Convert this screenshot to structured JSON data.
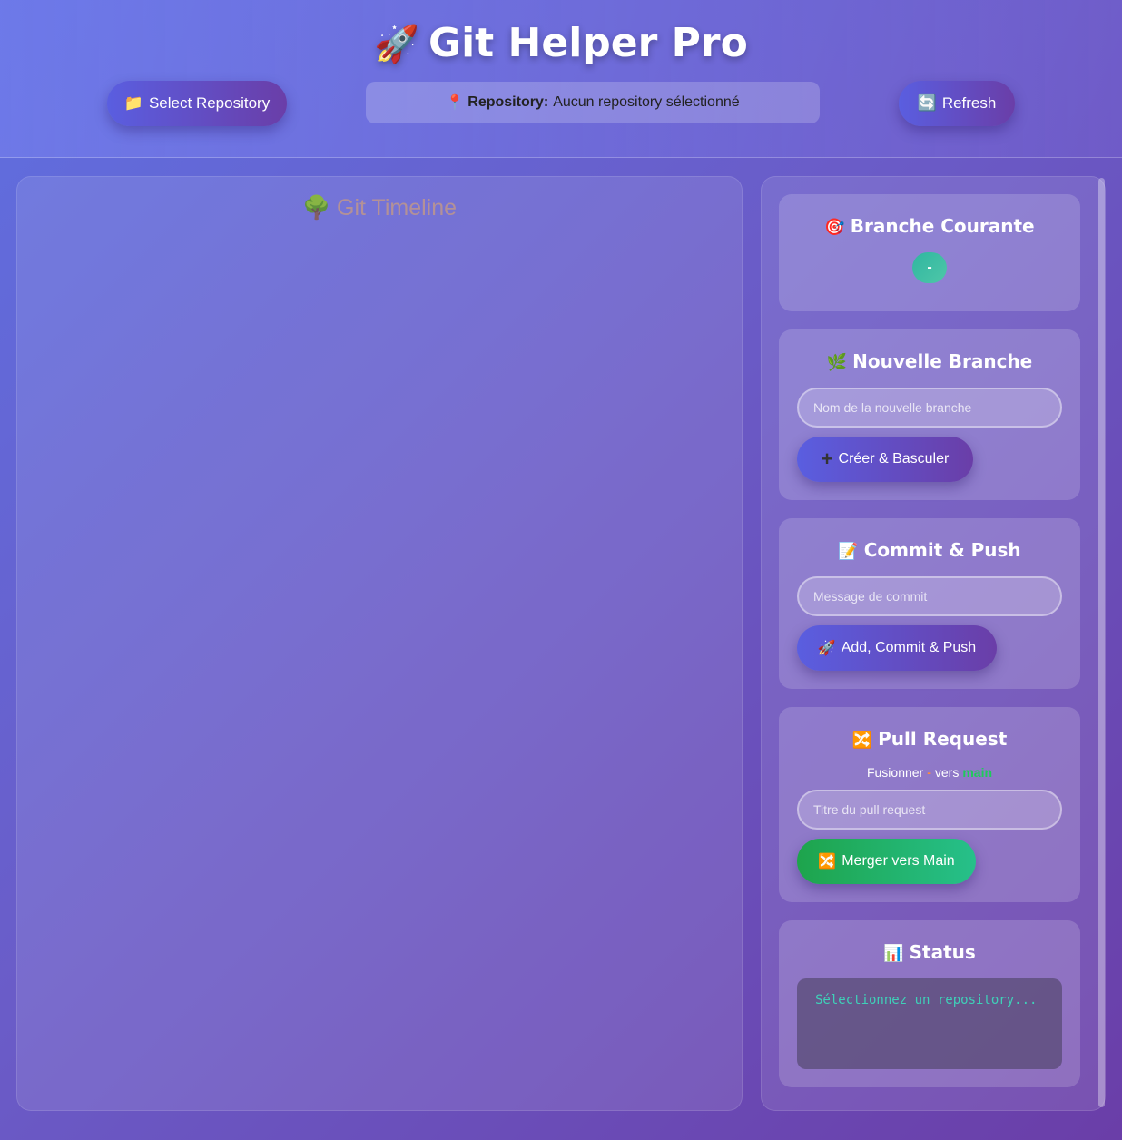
{
  "header": {
    "title_emoji": "🚀",
    "title": "Git Helper Pro",
    "select_repo": {
      "icon": "📁",
      "label": "Select Repository"
    },
    "repo_status": {
      "icon": "📍",
      "label": "Repository:",
      "value": "Aucun repository sélectionné"
    },
    "refresh": {
      "icon": "🔄",
      "label": "Refresh"
    }
  },
  "timeline": {
    "icon": "🌳",
    "title": "Git Timeline"
  },
  "current_branch": {
    "icon": "🎯",
    "title": "Branche Courante",
    "value": "-"
  },
  "new_branch": {
    "icon": "🌿",
    "title": "Nouvelle Branche",
    "placeholder": "Nom de la nouvelle branche",
    "button_icon": "➕",
    "button_label": "Créer & Basculer"
  },
  "commit": {
    "icon": "📝",
    "title": "Commit & Push",
    "placeholder": "Message de commit",
    "button_icon": "🚀",
    "button_label": "Add, Commit & Push"
  },
  "pull_request": {
    "icon": "🔀",
    "title": "Pull Request",
    "merge_prefix": "Fusionner",
    "source": "-",
    "merge_mid": "vers",
    "target": "main",
    "placeholder": "Titre du pull request",
    "button_icon": "🔀",
    "button_label": "Merger vers Main"
  },
  "status": {
    "icon": "📊",
    "title": "Status",
    "text": "Sélectionnez un repository..."
  },
  "colors": {
    "accent_start": "#5a5ee0",
    "accent_end": "#6a3ea8",
    "merge_green": "#1ea44c",
    "source_orange": "#ff8a3d",
    "target_green": "#1ecb5a",
    "status_text": "#3fd0b8"
  }
}
